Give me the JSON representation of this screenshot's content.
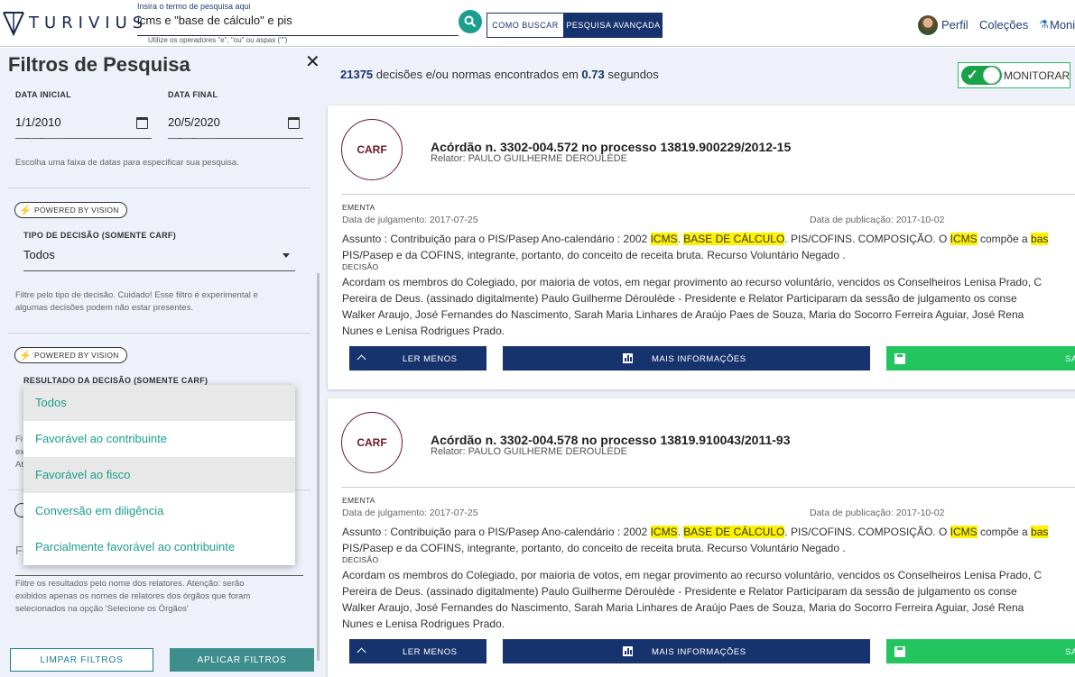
{
  "header": {
    "logo_text": "TURIVIUS",
    "search_label": "Insira o termo de pesquisa aqui",
    "search_value": "icms e \"base de cálculo\" e pis",
    "search_hint": "Utilize os operadores \"e\", \"ou\" ou aspas (\"\")",
    "como_buscar": "COMO BUSCAR",
    "pesquisa_avancada": "PESQUISA AVANÇADA",
    "perfil": "Perfil",
    "colecoes": "Coleções",
    "monitoramento": "Moni",
    "brand_color": "#17336e",
    "accent_color": "#1b9e8e"
  },
  "sidebar": {
    "title": "Filtros de Pesquisa",
    "data_inicial_label": "DATA INICIAL",
    "data_inicial_value": "1/1/2010",
    "data_final_label": "DATA FINAL",
    "data_final_value": "20/5/2020",
    "date_mask": "__ __ ____",
    "date_help": "Escolha uma faixa de datas para especificar sua pesquisa.",
    "vision_badge": "POWERED BY VISION",
    "tipo_label": "TIPO DE DECISÃO (SOMENTE CARF)",
    "tipo_value": "Todos",
    "tipo_help_1": "Filtre pelo tipo de decisão. Cuidado! Esse filtro é experimental e",
    "tipo_help_2": "algumas decisões podem não estar presentes.",
    "resultado_label": "RESULTADO DA DECISÃO (SOMENTE CARF)",
    "resultado_options": [
      "Todos",
      "Favorável ao contribuinte",
      "Favorável ao fisco",
      "Conversão em diligência",
      "Parcialmente favorável ao contribuinte"
    ],
    "peek_a_1": "Fi",
    "peek_a_2": "ex",
    "peek_a_3": "At",
    "relatores_placeholder": "Fi",
    "relatores_help_1": "Filtre os resultados pelo nome dos relatores. Atenção: serão",
    "relatores_help_2": "exibidos apenas os nomes de relatores dos órgãos que foram",
    "relatores_help_3": "selecionados na opção 'Selecione os Órgãos'",
    "limpar": "LIMPAR FILTROS",
    "aplicar": "APLICAR FILTROS"
  },
  "main": {
    "result_count": "21375",
    "result_text": "decisões e/ou normas encontrados em",
    "result_time": "0.73",
    "result_unit": "segundos",
    "monitorar": "MONITORAR",
    "monitorar_on": true,
    "cards": [
      {
        "badge": "CARF",
        "title": "Acórdão n. 3302-004.572 no processo 13819.900229/2012-15",
        "relator": "Relator: PAULO GUILHERME DEROULÈDE",
        "ementa_label": "EMENTA",
        "data_julgamento": "Data de julgamento: 2017-07-25",
        "data_publicacao": "Data de publicação: 2017-10-02",
        "assunto_1a": "Assunto : Contribuição para o PIS/Pasep Ano-calendário : 2002 ",
        "hl_icms": "ICMS",
        "sep_1": ". ",
        "hl_base": "BASE DE CÁLCULO",
        "assunto_1b": ". PIS/COFINS. COMPOSIÇÃO. O ",
        "hl_icms_2": "ICMS",
        "assunto_1c": " compõe a ",
        "hl_bas": "bas",
        "assunto_2": "PIS/Pasep e da COFINS, integrante, portanto, do conceito de receita bruta. Recurso Voluntário Negado .",
        "decisao_label": "DECISÃO",
        "decisao_1": "Acordam os membros do Colegiado, por maioria de votos, em negar provimento ao recurso voluntário, vencidos os Conselheiros Lenisa Prado, C",
        "decisao_2": "Pereira de Deus. (assinado digitalmente) Paulo Guilherme Déroulède - Presidente e Relator Participaram da sessão de julgamento os conse",
        "decisao_3": "Walker Araujo, José Fernandes do Nascimento, Sarah Maria Linhares de Araújo Paes de Souza, Maria do Socorro Ferreira Aguiar, José Rena",
        "decisao_4": "Nunes e Lenisa Rodrigues Prado.",
        "ler_menos": "LER MENOS",
        "mais_info": "MAIS INFORMAÇÕES",
        "salvar": "SA"
      },
      {
        "badge": "CARF",
        "title": "Acórdão n. 3302-004.578 no processo 13819.910043/2011-93",
        "relator": "Relator: PAULO GUILHERME DEROULÈDE",
        "ementa_label": "EMENTA",
        "data_julgamento": "Data de julgamento: 2017-07-25",
        "data_publicacao": "Data de publicação: 2017-10-02",
        "assunto_1a": "Assunto : Contribuição para o PIS/Pasep Ano-calendário : 2002 ",
        "hl_icms": "ICMS",
        "sep_1": ". ",
        "hl_base": "BASE DE CÁLCULO",
        "assunto_1b": ". PIS/COFINS. COMPOSIÇÃO. O ",
        "hl_icms_2": "ICMS",
        "assunto_1c": " compõe a ",
        "hl_bas": "bas",
        "assunto_2": "PIS/Pasep e da COFINS, integrante, portanto, do conceito de receita bruta. Recurso Voluntário Negado .",
        "decisao_label": "DECISÃO",
        "decisao_1": "Acordam os membros do Colegiado, por maioria de votos, em negar provimento ao recurso voluntário, vencidos os Conselheiros Lenisa Prado, C",
        "decisao_2": "Pereira de Deus. (assinado digitalmente) Paulo Guilherme Déroulède - Presidente e Relator Participaram da sessão de julgamento os conse",
        "decisao_3": "Walker Araujo, José Fernandes do Nascimento, Sarah Maria Linhares de Araújo Paes de Souza, Maria do Socorro Ferreira Aguiar, José Rena",
        "decisao_4": "Nunes e Lenisa Rodrigues Prado.",
        "ler_menos": "LER MENOS",
        "mais_info": "MAIS INFORMAÇÕES",
        "salvar": "SA"
      }
    ]
  }
}
